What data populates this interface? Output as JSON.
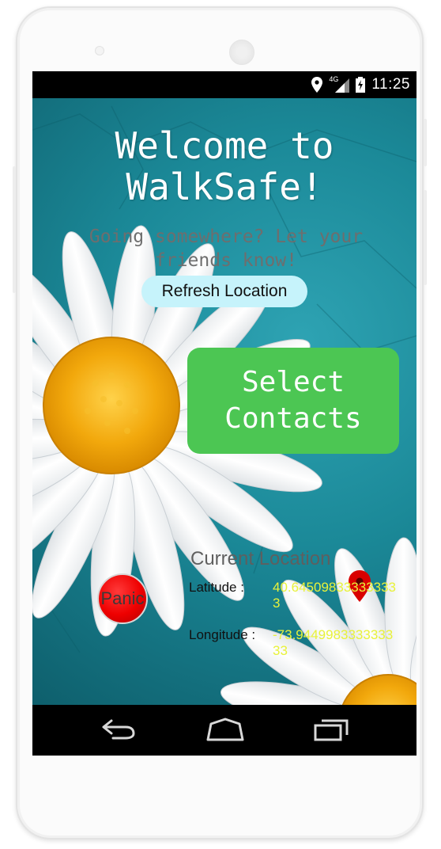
{
  "status": {
    "icons": [
      "location-pin-icon",
      "4g-signal-icon",
      "battery-charging-icon"
    ],
    "network_label": "4G",
    "time": "11:25"
  },
  "app": {
    "title_line1": "Welcome to",
    "title_line2": "WalkSafe!",
    "subtitle": "Going somewhere? Let your friends know!",
    "refresh_label": "Refresh Location",
    "contacts_label_line1": "Select",
    "contacts_label_line2": "Contacts",
    "panic_label": "Panic",
    "location": {
      "heading": "Current Location",
      "latitude_label": "Latitude :",
      "latitude_value": "40.645098333333333",
      "longitude_label": "Longitude :",
      "longitude_value": "-73.944998333333333"
    }
  },
  "navigation": {
    "buttons": [
      "back-icon",
      "home-icon",
      "recent-apps-icon"
    ]
  },
  "colors": {
    "background_teal": "#1b8998",
    "contacts_button": "#4cc653",
    "refresh_button": "#c6f3fb",
    "panic_button": "#ee0000",
    "coordinate_text": "#e8f23a",
    "marker": "#d90000"
  }
}
